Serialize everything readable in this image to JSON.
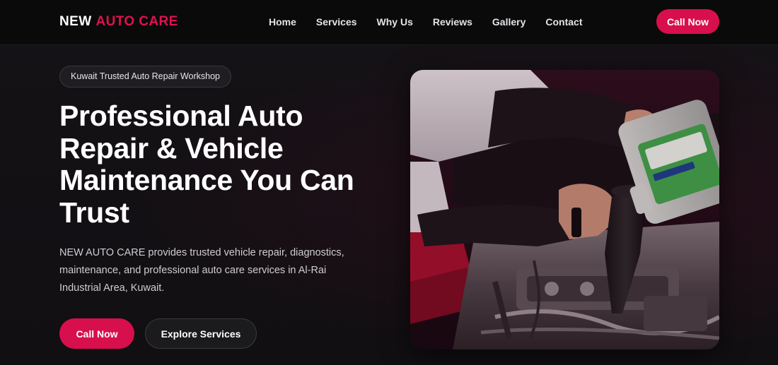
{
  "brand": {
    "name_part1": "NEW",
    "name_part2": "AUTO CARE",
    "accent_color": "#d80f4d"
  },
  "nav": {
    "items": [
      {
        "label": "Home"
      },
      {
        "label": "Services"
      },
      {
        "label": "Why Us"
      },
      {
        "label": "Reviews"
      },
      {
        "label": "Gallery"
      },
      {
        "label": "Contact"
      }
    ],
    "cta_label": "Call Now"
  },
  "hero": {
    "badge": "Kuwait Trusted Auto Repair Workshop",
    "title": "Professional Auto Repair & Vehicle Maintenance You Can Trust",
    "description": "NEW AUTO CARE provides trusted vehicle repair, diagnostics, maintenance, and professional auto care services in Al-Rai Industrial Area, Kuwait.",
    "primary_button": "Call Now",
    "secondary_button": "Explore Services",
    "image_icon": "mechanic-pouring-oil-photo"
  }
}
